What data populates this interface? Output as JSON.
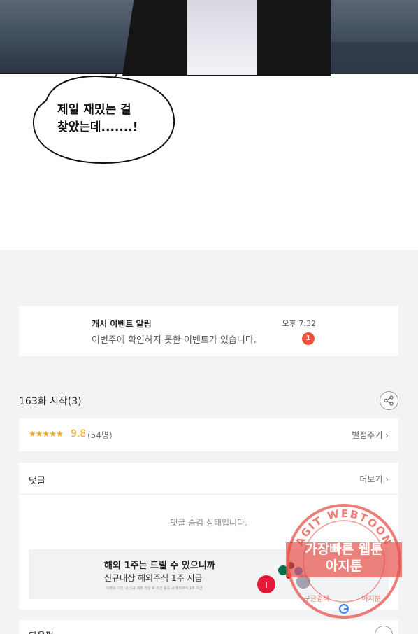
{
  "comic": {
    "speech_line1": "제일 재밌는 걸",
    "speech_line2": "찾았는데.......!"
  },
  "event": {
    "title": "캐시 이벤트 알림",
    "description": "이번주에 확인하지 못한 이벤트가 있습니다.",
    "time": "오후 7:32",
    "badge_count": "1"
  },
  "episode": {
    "title": "163화 시작(3)",
    "share_icon": "share-icon"
  },
  "rating": {
    "stars": "★★★★★",
    "score": "9.8",
    "count": "(54명)",
    "rate_link": "별점주기 ›"
  },
  "comments": {
    "label": "댓글",
    "more_link": "더보기 ›",
    "hidden_message": "댓글 숨김 상태입니다."
  },
  "ad": {
    "title": "해외 1주는 드릴 수 있으니까",
    "subtitle": "신규대상 해외주식 1주 지급",
    "fine_print": "· 이벤트 기간 내 신규 계좌 개설 후 조건 충족 시 해외주식 1주 지급"
  },
  "next": {
    "label": "다음편"
  },
  "watermark": {
    "arc_top": "AGIT WEBTOON",
    "line1": "가장빠른 웹툰",
    "line2": "아지툰",
    "arc_bottom_left": "구글검색",
    "arc_bottom_right": "아지툰"
  },
  "colors": {
    "accent_star": "#f5a623",
    "badge": "#e9533b",
    "watermark": "#e8514a"
  }
}
